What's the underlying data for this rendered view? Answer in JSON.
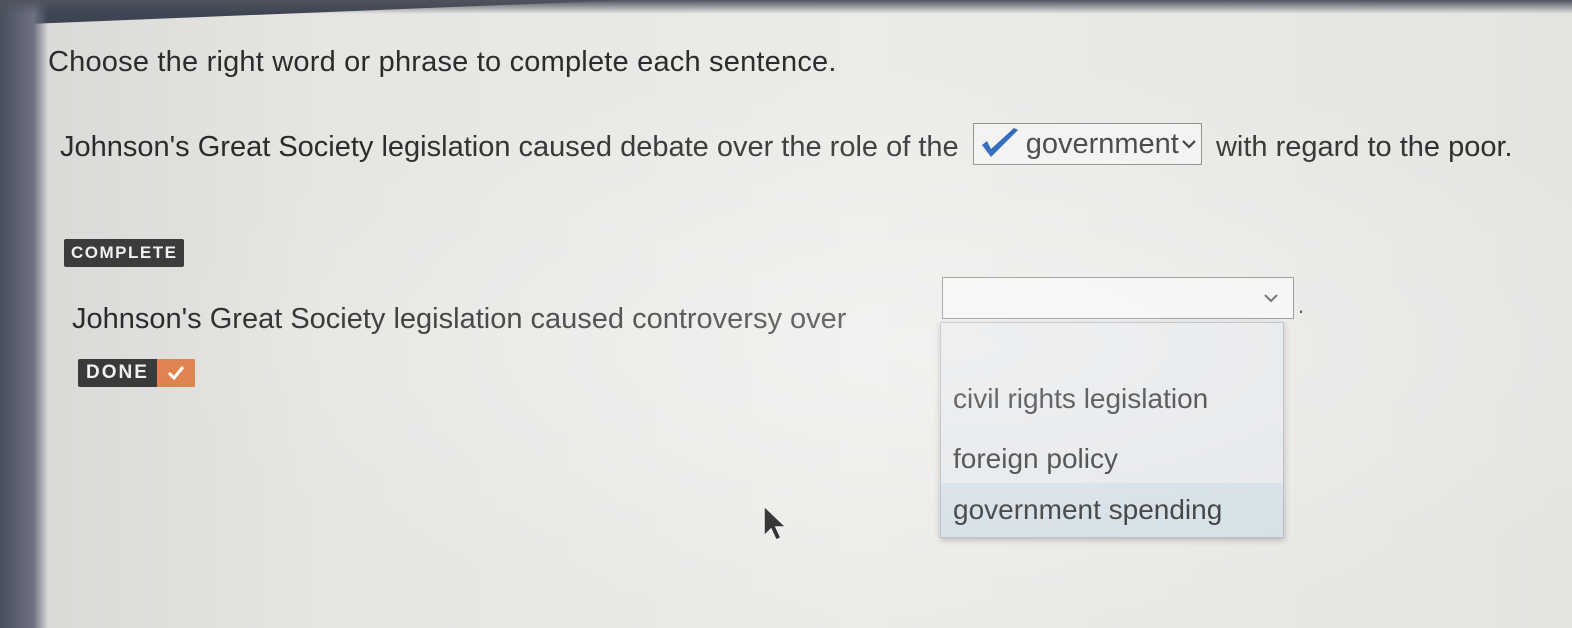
{
  "instruction": "Choose the right word or phrase to complete each sentence.",
  "question1": {
    "before": "Johnson's Great Society legislation caused debate over the role of the",
    "selected": "government",
    "after": "with regard to the poor.",
    "status_badge": "COMPLETE"
  },
  "question2": {
    "before": "Johnson's Great Society legislation caused controversy over",
    "after": ".",
    "selected": "",
    "options": [
      "civil rights legislation",
      "foreign policy",
      "government spending"
    ],
    "highlighted_option": "government spending"
  },
  "done_badge": "DONE",
  "colors": {
    "check_blue": "#1e5db8",
    "done_check_bg": "#e0824f",
    "badge_bg": "#3c3c3c",
    "option_highlight": "#d3dee6"
  },
  "icons": {
    "answer_check": "checkmark-icon",
    "dropdown_caret": "chevron-down-icon",
    "done_check": "checkmark-icon",
    "pointer": "mouse-cursor-icon"
  }
}
